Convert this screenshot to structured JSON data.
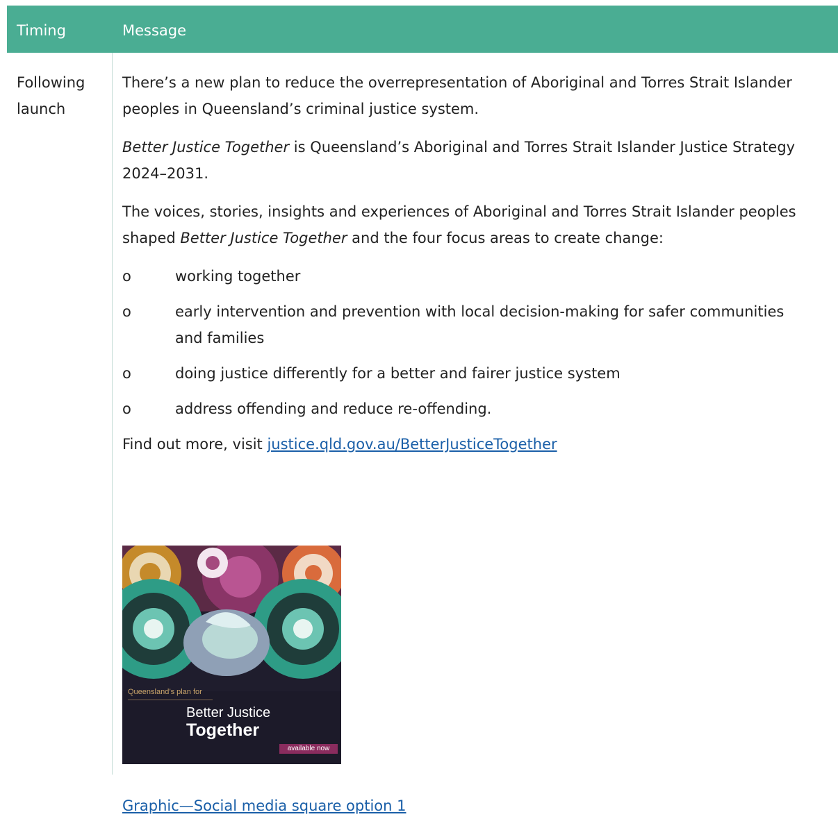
{
  "table": {
    "headers": {
      "timing": "Timing",
      "message": "Message"
    },
    "row": {
      "timing_line1": "Following",
      "timing_line2": "launch",
      "para1": "There’s a new plan to reduce the overrepresentation of Aboriginal and Torres Strait Islander peoples in Queensland’s criminal justice system.",
      "para2_italic": "Better Justice Together",
      "para2_rest": " is Queensland’s Aboriginal and Torres Strait Islander Justice Strategy 2024–2031.",
      "para3_start": "The voices, stories, insights and experiences of Aboriginal and Torres Strait Islander peoples shaped ",
      "para3_italic": "Better Justice Together",
      "para3_end": " and the four focus areas to create change:",
      "bullet_mark": "o",
      "bullets": [
        "working together",
        "early intervention and prevention with local decision-making for safer communities and families",
        "doing justice differently for a better and fairer justice system",
        "address offending and reduce re-offending."
      ],
      "find_out_text": "Find out more, visit ",
      "find_out_link": "justice.qld.gov.au/BetterJusticeTogether",
      "graphic": {
        "small_text": "Queensland’s plan for",
        "title_line1": "Better Justice",
        "title_line2": "Together",
        "badge": "available now"
      },
      "graphic_link": "Graphic—Social media square option 1"
    }
  },
  "colors": {
    "header_bg": "#4aad93",
    "link": "#1a5fa8",
    "divider": "#c5ddd6"
  }
}
